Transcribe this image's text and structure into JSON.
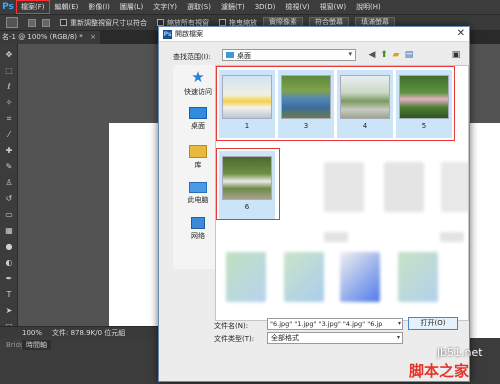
{
  "ps": {
    "logo": "Ps",
    "menu": [
      "檔案(F)",
      "編輯(E)",
      "影像(I)",
      "圖層(L)",
      "文字(Y)",
      "選取(S)",
      "濾鏡(T)",
      "3D(D)",
      "檢視(V)",
      "視窗(W)",
      "說明(H)"
    ],
    "options": {
      "resize_check": "重新調整視窗尺寸以符合",
      "zoom_all": "縮放所有視窗",
      "scrubby": "拖曳縮放",
      "actual_pixels": "實際像素",
      "fit_screen": "符合螢幕",
      "fill_screen": "填滿螢幕"
    },
    "doc_tab": "名-1 @ 100% (RGB/8) *",
    "doc_tab_close": "×",
    "status_zoom": "100%",
    "status_doc": "文件: 878.9K/0 位元組",
    "bottom_tab": "時間軸",
    "bottom_label": "Bridge"
  },
  "dialog": {
    "title": "開啟檔案",
    "close": "✕",
    "look_in_label": "查找范围(I):",
    "look_in_value": "桌面",
    "places": [
      "快速访问",
      "桌面",
      "库",
      "此电脑",
      "网络"
    ],
    "files": [
      {
        "name": "1",
        "selected": true
      },
      {
        "name": "3",
        "selected": true
      },
      {
        "name": "4",
        "selected": true
      },
      {
        "name": "5",
        "selected": true
      },
      {
        "name": "6",
        "selected": true
      }
    ],
    "filename_label": "文件名(N):",
    "filename_value": "\"6.jpg\" \"1.jpg\" \"3.jpg\" \"4.jpg\" \"6.jp",
    "filetype_label": "文件类型(T):",
    "filetype_value": "全部格式",
    "open_label": "打开(O)"
  },
  "watermark": {
    "site": "jb51.net",
    "brand": "脚本之家"
  },
  "colors": {
    "highlight_red": "#e83a3a",
    "selection": "#cce4f7",
    "ps_dark": "#3c3c3c"
  }
}
